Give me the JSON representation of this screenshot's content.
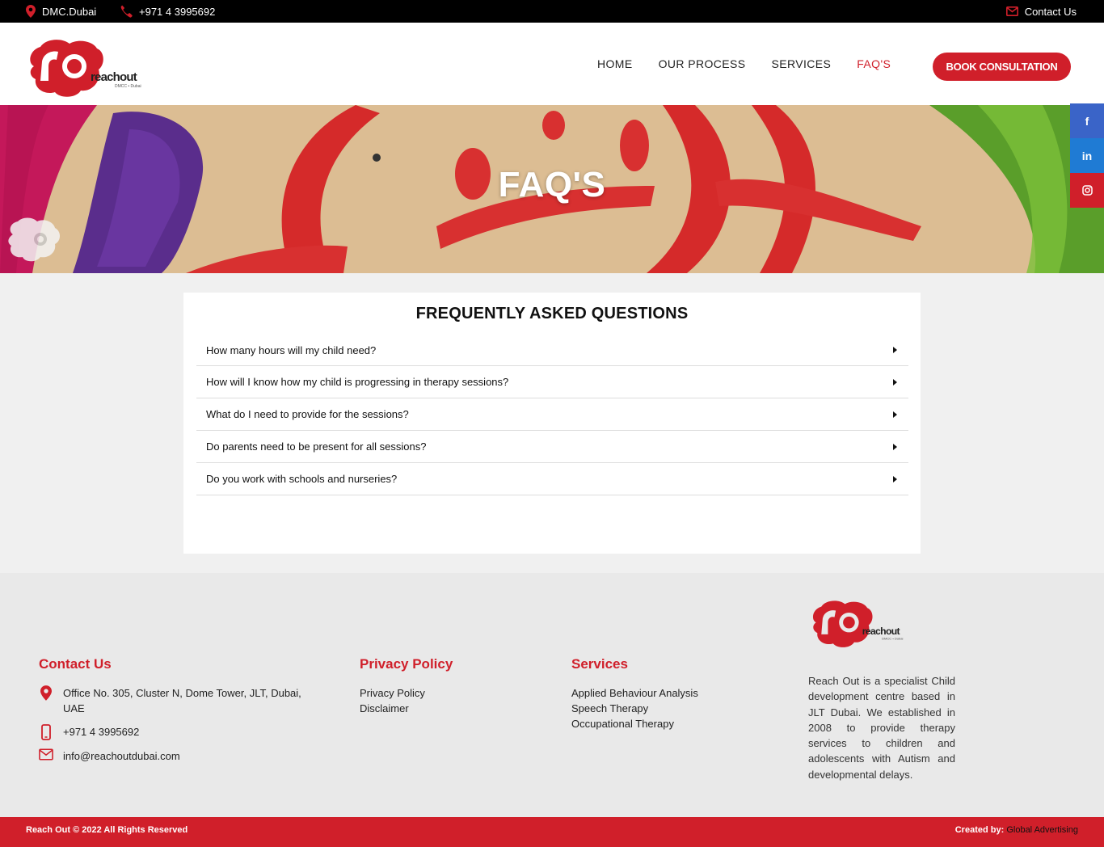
{
  "topbar": {
    "location": "DMC.Dubai",
    "phone": "+971 4 3995692",
    "contact_link": "Contact Us",
    "location_icon": "map-pin-icon",
    "phone_icon": "phone-icon",
    "contact_icon": "envelope-icon"
  },
  "header": {
    "logo_text": "reachout",
    "logo_sub": "DMCC • Dubai",
    "nav": [
      {
        "label": "HOME",
        "active": false
      },
      {
        "label": "OUR PROCESS",
        "active": false
      },
      {
        "label": "SERVICES",
        "active": false
      },
      {
        "label": "FAQ'S",
        "active": true
      }
    ],
    "cta_label": "BOOK CONSULTATION"
  },
  "hero": {
    "title": "FAQ'S"
  },
  "social": [
    {
      "name": "facebook-icon",
      "glyph": "f",
      "color": "#3a64c8"
    },
    {
      "name": "linkedin-icon",
      "glyph": "in",
      "color": "#1f7bd4"
    },
    {
      "name": "instagram-icon",
      "glyph": "◎",
      "color": "#d01f2a"
    }
  ],
  "faq": {
    "title": "FREQUENTLY ASKED QUESTIONS",
    "items": [
      "How many hours will my child need?",
      "How will I know how my child is progressing in therapy sessions?",
      "What do I need to provide for the sessions?",
      "Do parents need to be present for all sessions?",
      "Do you work with schools and nurseries?"
    ]
  },
  "footer": {
    "contact": {
      "heading": "Contact Us",
      "address": "Office No. 305, Cluster N, Dome Tower, JLT, Dubai, UAE",
      "phone": "+971 4 3995692",
      "email": "info@reachoutdubai.com"
    },
    "privacy": {
      "heading": "Privacy Policy",
      "links": [
        "Privacy Policy",
        "Disclaimer"
      ]
    },
    "services": {
      "heading": "Services",
      "links": [
        "Applied Behaviour Analysis",
        "Speech Therapy",
        "Occupational Therapy"
      ]
    },
    "about": {
      "text": "Reach Out is a specialist Child development centre based in JLT Dubai. We established in 2008 to provide therapy services to children and adolescents with Autism and developmental delays."
    }
  },
  "bottom": {
    "copyright": "Reach Out © 2022  All Rights Reserved",
    "created_by_label": "Created by:",
    "agency": "Global Advertising"
  },
  "colors": {
    "brand_red": "#d01f2a",
    "topbar_bg": "#000000",
    "footer_bg": "#e9e9e9"
  }
}
